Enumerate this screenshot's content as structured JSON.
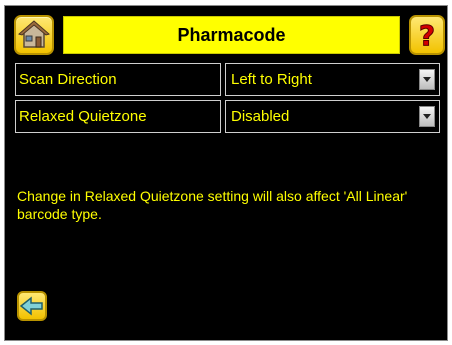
{
  "header": {
    "title": "Pharmacode",
    "home_icon": "home-icon",
    "help_icon": "question-mark-icon",
    "help_glyph": "?"
  },
  "settings": [
    {
      "label": "Scan Direction",
      "value": "Left to Right"
    },
    {
      "label": "Relaxed Quietzone",
      "value": "Disabled"
    }
  ],
  "message": "Change in Relaxed Quietzone setting will also affect 'All Linear' barcode type.",
  "footer": {
    "back_icon": "back-arrow-icon"
  },
  "colors": {
    "background": "#000000",
    "text": "#ffff00",
    "title_bar": "#ffff00",
    "button": "#f2c200"
  }
}
